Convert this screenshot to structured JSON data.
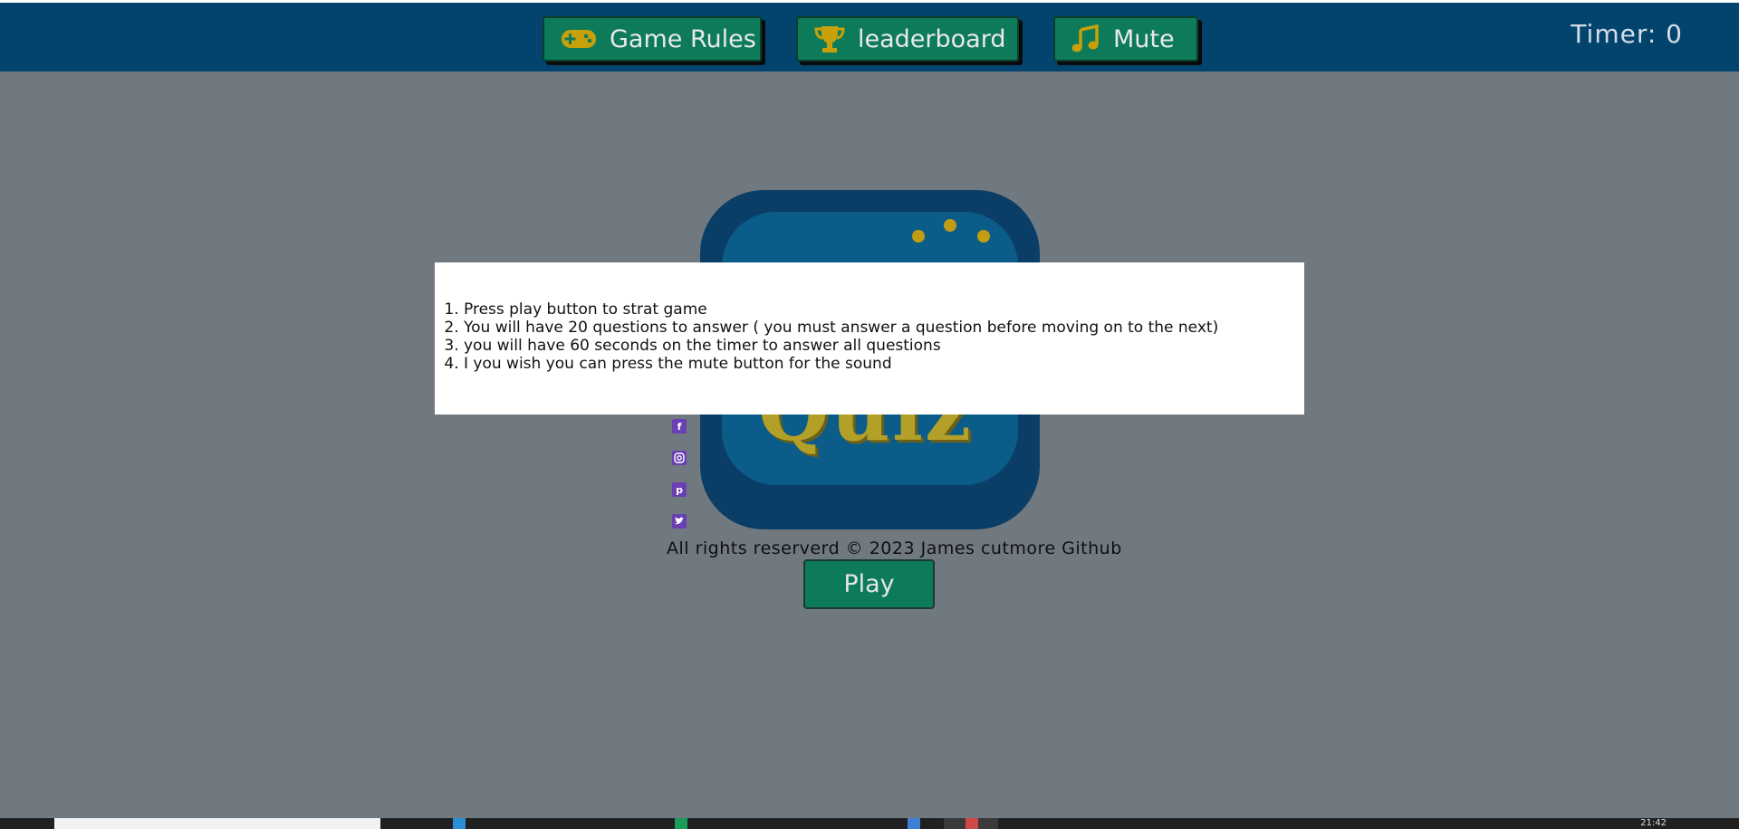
{
  "nav": {
    "rules_label": "Game Rules",
    "leaderboard_label": "leaderboard",
    "mute_label": "Mute",
    "timer_text": "Timer: 0"
  },
  "logo": {
    "text": "Quiz"
  },
  "rules": {
    "items": [
      "Press play button to strat game",
      "You will have 20 questions to answer ( you must answer a question before moving on to the next)",
      "you will have 60 seconds on the timer to answer all questions",
      "I you wish you can press the mute button for the sound"
    ]
  },
  "footer": {
    "text": "All rights reserverd © 2023 James cutmore Github"
  },
  "play": {
    "label": "Play"
  },
  "social": [
    "facebook-icon",
    "instagram-icon",
    "pinterest-icon",
    "twitter-icon"
  ],
  "taskbar": {
    "clock": "21:42"
  },
  "colors": {
    "topbar": "#03446f",
    "button": "#0d7b5a",
    "icon_gold": "#c8a10a",
    "overlay": "#717980",
    "social": "#6a3fb3"
  }
}
